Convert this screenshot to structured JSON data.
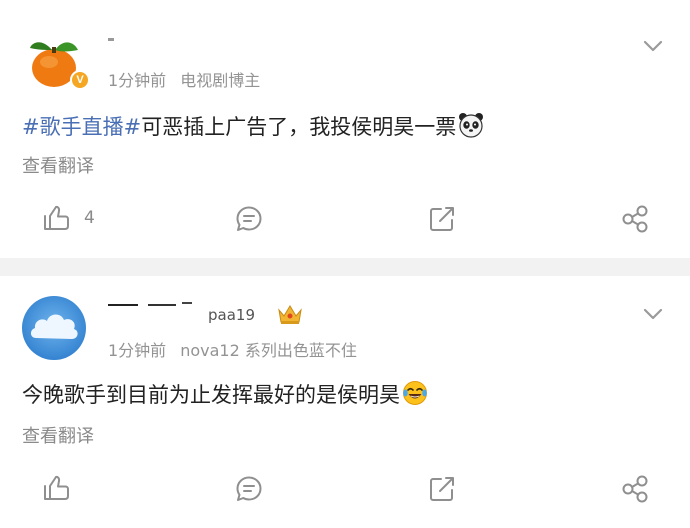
{
  "posts": [
    {
      "time": "1分钟前",
      "source": "电视剧博主",
      "verified_badge": "V",
      "hashtag": "#歌手直播#",
      "text": "可恶插上广告了，我投侯明昊一票",
      "translate": "查看翻译",
      "likes": "4",
      "emoji": "panda-face",
      "avatar": "mandarin-orange"
    },
    {
      "username_partial": "paa19",
      "time": "1分钟前",
      "source": "nova12 系列出色蓝不住",
      "text": "今晚歌手到目前为止发挥最好的是侯明昊",
      "translate": "查看翻译",
      "emoji": "laughing-tears-face",
      "avatar": "blue-cloud",
      "badge": "crown"
    }
  ],
  "colors": {
    "hashtag": "#4a6fb5",
    "meta_gray": "#939393",
    "icon_gray": "#8f8f8f",
    "verified_orange": "#f5a623"
  },
  "icons": [
    "like-icon",
    "comment-icon",
    "repost-icon",
    "share-icon",
    "chevron-down-icon"
  ]
}
